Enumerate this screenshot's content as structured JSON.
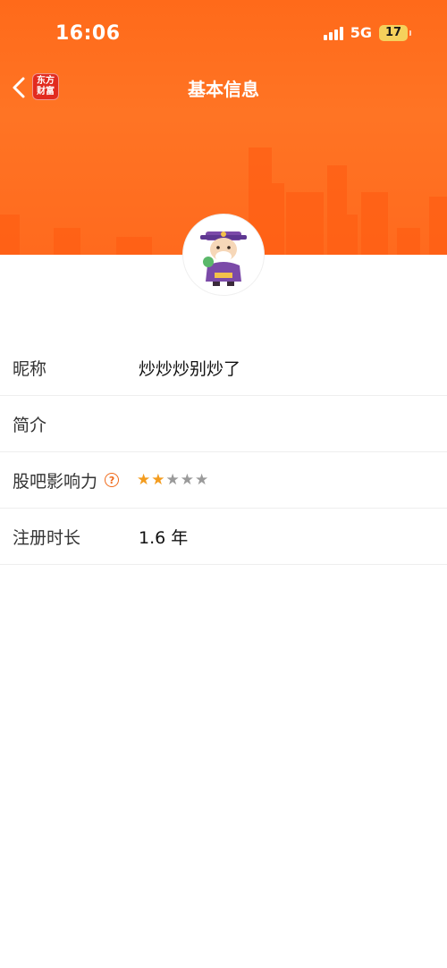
{
  "status_bar": {
    "time": "16:06",
    "network": "5G",
    "battery": "17"
  },
  "nav": {
    "title": "基本信息",
    "brand_line1": "东方",
    "brand_line2": "财富"
  },
  "profile": {
    "rows": [
      {
        "label": "昵称",
        "value": "炒炒炒别炒了"
      },
      {
        "label": "简介",
        "value": ""
      },
      {
        "label": "股吧影响力",
        "rating": 2,
        "rating_max": 5
      },
      {
        "label": "注册时长",
        "value": "1.6 年"
      }
    ]
  },
  "colors": {
    "header": "#ff6a1a",
    "accent": "#f06a1a",
    "star_on": "#f39c1f",
    "star_off": "#9a9a9a"
  },
  "icons": [
    "back-chevron-icon",
    "signal-icon",
    "battery-icon",
    "help-circle-icon",
    "star-icon"
  ]
}
